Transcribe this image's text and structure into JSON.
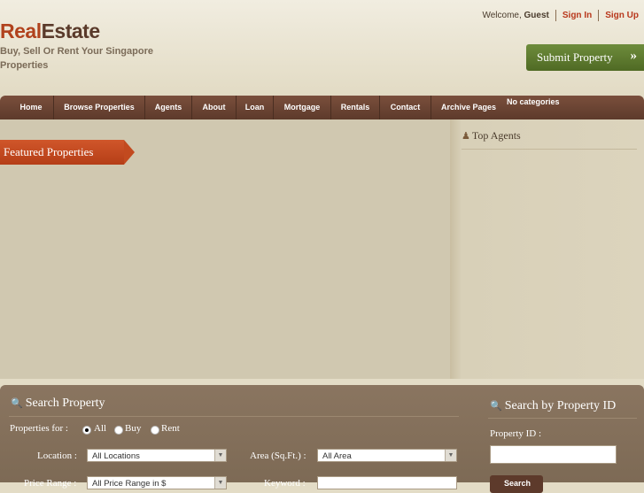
{
  "header": {
    "logo_real": "Real",
    "logo_estate": "Estate",
    "tagline": "Buy, Sell Or Rent Your Singapore Properties",
    "welcome": "Welcome,",
    "user": "Guest",
    "sign_in": "Sign In",
    "sign_up": "Sign Up",
    "submit_property": "Submit Property",
    "submit_arrows": "»"
  },
  "nav": {
    "items": [
      "Home",
      "Browse Properties",
      "Agents",
      "About",
      "Loan",
      "Mortgage",
      "Rentals",
      "Contact",
      "Archive Pages"
    ],
    "no_categories": "No categories"
  },
  "main": {
    "featured": "Featured Properties",
    "top_agents": "Top Agents"
  },
  "search": {
    "title": "Search Property",
    "properties_for": "Properties for :",
    "opt_all": "All",
    "opt_buy": "Buy",
    "opt_rent": "Rent",
    "location_label": "Location :",
    "location_value": "All Locations",
    "area_label": "Area (Sq.Ft.) :",
    "area_value": "All Area",
    "price_label": "Price Range :",
    "price_value": "All Price Range in $",
    "keyword_label": "Keyword :"
  },
  "search_id": {
    "title": "Search by Property ID",
    "id_label": "Property ID :",
    "button": "Search"
  },
  "colors": {
    "accent": "#b8371b",
    "nav_bg": "#6d4533",
    "submit_green": "#5d7a2e",
    "search_panel": "#847060"
  },
  "icons": [
    "magnifier-icon",
    "agent-icon",
    "double-arrow-icon",
    "dropdown-arrow-icon"
  ]
}
